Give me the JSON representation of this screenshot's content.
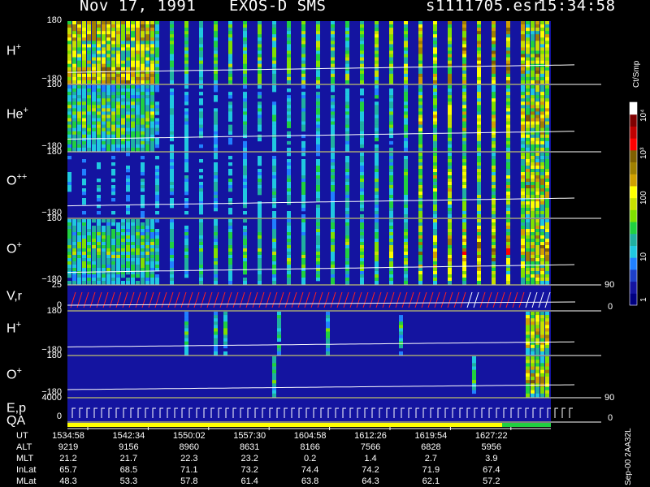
{
  "header": {
    "date": "Nov 17, 1991",
    "instrument": "EXOS-D SMS",
    "file": "s1111705.esr",
    "time": "15:34:58"
  },
  "panels": [
    {
      "id": "h-plus",
      "label": "H",
      "sup": "+",
      "ytop": "180",
      "ybot": "−180"
    },
    {
      "id": "he-plus",
      "label": "He",
      "sup": "+",
      "ytop": "180",
      "ybot": "−180"
    },
    {
      "id": "o-plus-plus",
      "label": "O",
      "sup": "++",
      "ytop": "180",
      "ybot": "−180"
    },
    {
      "id": "o-plus",
      "label": "O",
      "sup": "+",
      "ytop": "180",
      "ybot": "−180"
    },
    {
      "id": "v-r",
      "label": "V,r",
      "sup": "",
      "ytop": "25",
      "ybot": "0",
      "rtop": "90",
      "rbot": "0"
    },
    {
      "id": "h-plus-2",
      "label": "H",
      "sup": "+",
      "ytop": "180",
      "ybot": "−180"
    },
    {
      "id": "o-plus-2",
      "label": "O",
      "sup": "+",
      "ytop": "180",
      "ybot": "−180"
    },
    {
      "id": "e-p",
      "label": "E,p",
      "sup": "",
      "ytop": "4000",
      "ybot": "0",
      "rtop": "90",
      "rbot": "0"
    }
  ],
  "qa_label": "QA",
  "colorbar": {
    "unit": "Ct/Smp",
    "ticks": [
      "1",
      "10",
      "100",
      "10³",
      "10⁴"
    ],
    "colors": [
      "#000080",
      "#1414a0",
      "#1e40c8",
      "#2080ff",
      "#20c8e0",
      "#20b0a0",
      "#20d040",
      "#80e000",
      "#c8e000",
      "#ffff00",
      "#d0a000",
      "#a08000",
      "#806000",
      "#ff0000",
      "#c00000",
      "#800000",
      "#ffffff"
    ]
  },
  "footer_vertical": "Sep-00 2AA32L",
  "table": {
    "rows": [
      {
        "label": "UT",
        "values": [
          "1534:58",
          "1542:34",
          "1550:02",
          "1557:30",
          "1604:58",
          "1612:26",
          "1619:54",
          "1627:22"
        ]
      },
      {
        "label": "ALT",
        "values": [
          "9219",
          "9156",
          "8960",
          "8631",
          "8166",
          "7566",
          "6828",
          "5956"
        ]
      },
      {
        "label": "MLT",
        "values": [
          "21.2",
          "21.7",
          "22.3",
          "23.2",
          "0.2",
          "1.4",
          "2.7",
          "3.9"
        ]
      },
      {
        "label": "InLat",
        "values": [
          "65.7",
          "68.5",
          "71.1",
          "73.2",
          "74.4",
          "74.2",
          "71.9",
          "67.4"
        ]
      },
      {
        "label": "MLat",
        "values": [
          "48.3",
          "53.3",
          "57.8",
          "61.4",
          "63.8",
          "64.3",
          "62.1",
          "57.2"
        ]
      }
    ]
  },
  "chart_data": {
    "type": "heatmap",
    "title": "Nov 17, 1991   EXOS-D SMS   s1111705.esr   15:34:58",
    "x": [
      "1534:58",
      "1542:34",
      "1550:02",
      "1557:30",
      "1604:58",
      "1612:26",
      "1619:54",
      "1627:22"
    ],
    "colorscale": {
      "label": "Ct/Smp",
      "scale": "log",
      "range": [
        1,
        10000
      ]
    },
    "series": [
      {
        "name": "H+",
        "ylim": [
          -180,
          180
        ]
      },
      {
        "name": "He+",
        "ylim": [
          -180,
          180
        ]
      },
      {
        "name": "O++",
        "ylim": [
          -180,
          180
        ]
      },
      {
        "name": "O+",
        "ylim": [
          -180,
          180
        ]
      },
      {
        "name": "V,r",
        "ylim": [
          0,
          25
        ],
        "right_ylim": [
          0,
          90
        ]
      },
      {
        "name": "H+",
        "ylim": [
          -180,
          180
        ]
      },
      {
        "name": "O+",
        "ylim": [
          -180,
          180
        ]
      },
      {
        "name": "E,p",
        "ylim": [
          0,
          4000
        ],
        "right_ylim": [
          0,
          90
        ]
      }
    ]
  }
}
